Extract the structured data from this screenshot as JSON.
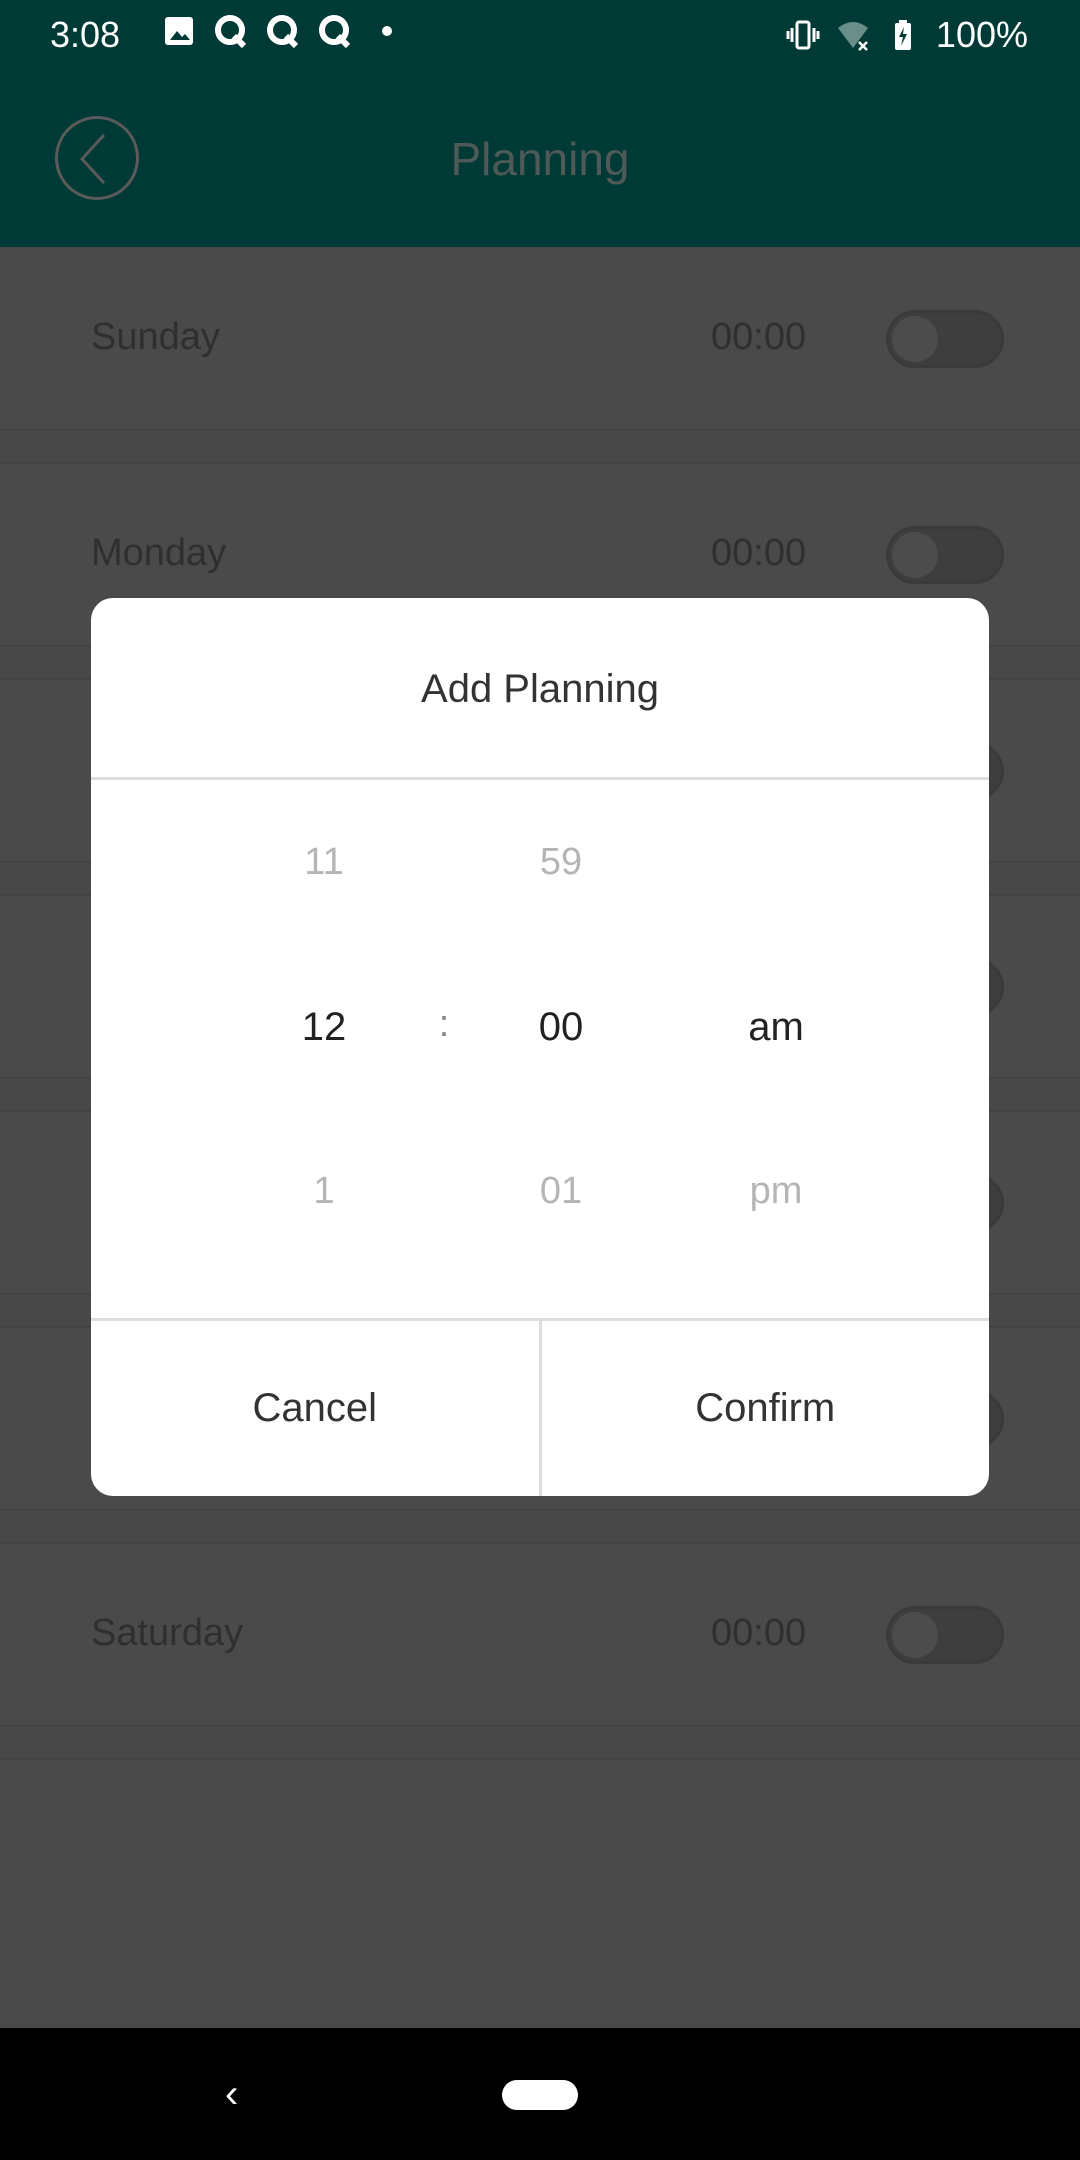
{
  "status_bar": {
    "time": "3:08",
    "battery": "100%",
    "icons_left": [
      "image-icon",
      "q-app-icon",
      "q-app-icon",
      "q-app-icon",
      "dot-icon"
    ],
    "icons_right": [
      "vibrate-icon",
      "wifi-off-icon",
      "battery-charging-icon"
    ]
  },
  "header": {
    "title": "Planning",
    "back_icon": "circle-chevron-left-icon"
  },
  "rows": [
    {
      "day": "Sunday",
      "time": "00:00",
      "enabled": false
    },
    {
      "day": "Monday",
      "time": "00:00",
      "enabled": false
    },
    {
      "enabled": false
    },
    {
      "enabled": false
    },
    {
      "enabled": false
    },
    {
      "enabled": false
    },
    {
      "day": "Saturday",
      "time": "00:00",
      "enabled": false
    }
  ],
  "dialog": {
    "title": "Add Planning",
    "hours": {
      "prev": "11",
      "selected": "12",
      "next": "1"
    },
    "separator": ":",
    "minutes": {
      "prev": "59",
      "selected": "00",
      "next": "01"
    },
    "period": {
      "selected": "am",
      "next": "pm"
    },
    "cancel": "Cancel",
    "confirm": "Confirm"
  },
  "colors": {
    "header": "#003a36",
    "overlay": "#4a4a4a",
    "dialog": "#ffffff"
  }
}
